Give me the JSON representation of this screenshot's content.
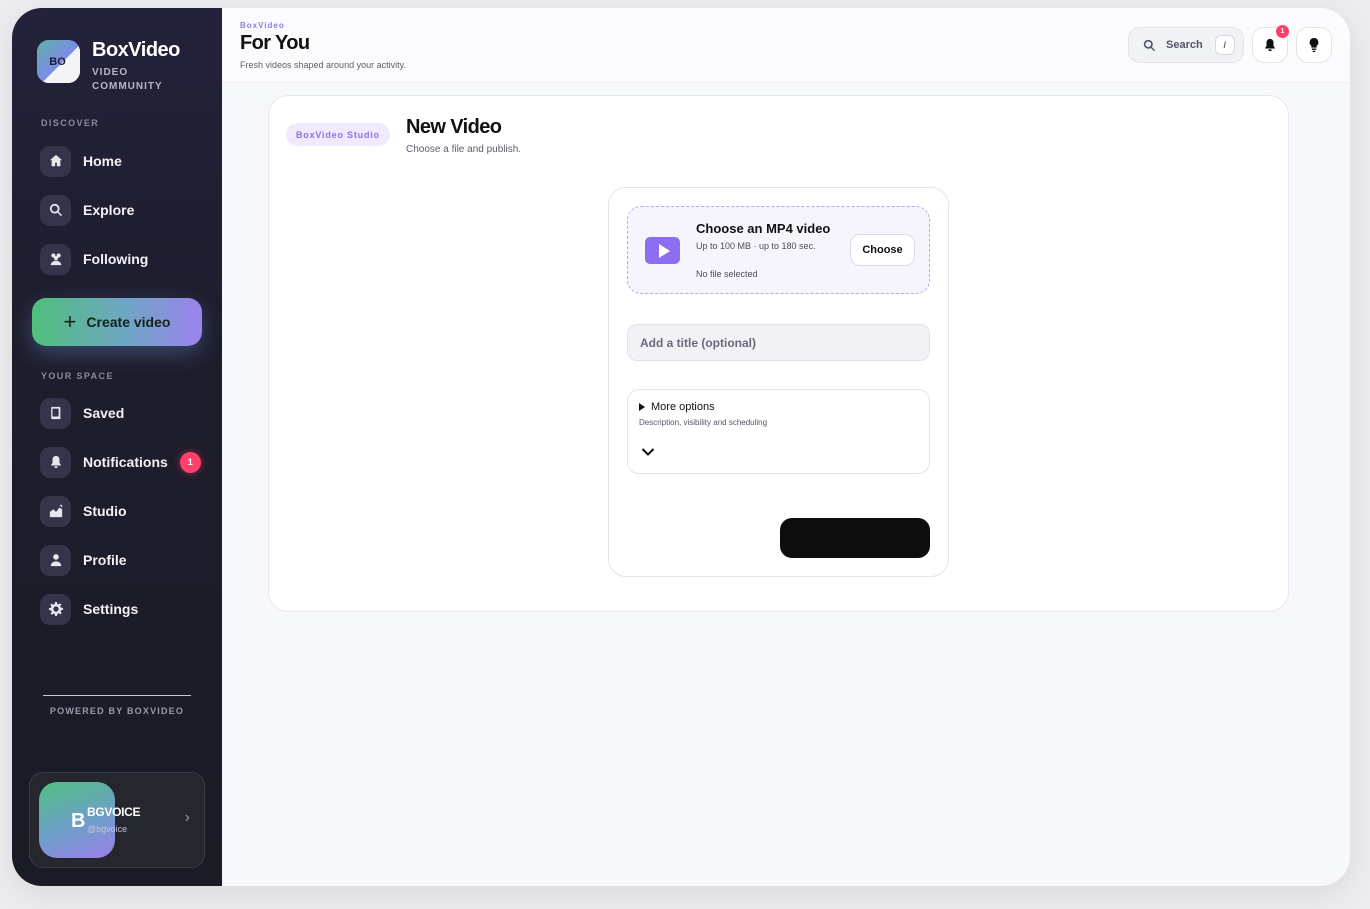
{
  "brand": {
    "logo_initials": "BO",
    "name": "BoxVideo",
    "subtitle": "VIDEO COMMUNITY"
  },
  "sidebar": {
    "discover_label": "DISCOVER",
    "discover_items": [
      {
        "label": "Home",
        "icon": "home-icon"
      },
      {
        "label": "Explore",
        "icon": "search-icon"
      },
      {
        "label": "Following",
        "icon": "users-icon"
      }
    ],
    "create_label": "Create video",
    "space_label": "YOUR SPACE",
    "space_items": [
      {
        "label": "Saved",
        "icon": "book-icon"
      },
      {
        "label": "Notifications",
        "icon": "bell-icon",
        "badge": "1"
      },
      {
        "label": "Studio",
        "icon": "chart-icon"
      },
      {
        "label": "Profile",
        "icon": "user-icon"
      },
      {
        "label": "Settings",
        "icon": "gear-icon"
      }
    ],
    "powered_by": "POWERED BY BOXVIDEO",
    "user": {
      "initial": "B",
      "name": "BGVOICE",
      "handle": "@bgvoice"
    }
  },
  "header": {
    "crumb": "BoxVideo",
    "title": "For You",
    "subtitle": "Fresh videos shaped around your activity.",
    "search_label": "Search",
    "search_shortcut": "/",
    "notification_count": "1"
  },
  "main": {
    "studio_pill": "BoxVideo Studio",
    "title": "New Video",
    "subtitle": "Choose a file and publish.",
    "upload": {
      "title": "Choose an MP4 video",
      "limits": "Up to 100 MB · up to 180 sec.",
      "status": "No file selected",
      "choose_label": "Choose"
    },
    "title_placeholder": "Add a title (optional)",
    "more_options": {
      "label": "More options",
      "description": "Description, visibility and scheduling"
    }
  },
  "colors": {
    "accent": "#8a7be6",
    "badge": "#ff3f6c",
    "sidebar_bg": "#1d1d2c",
    "publish_button": "#0d0d0d"
  }
}
